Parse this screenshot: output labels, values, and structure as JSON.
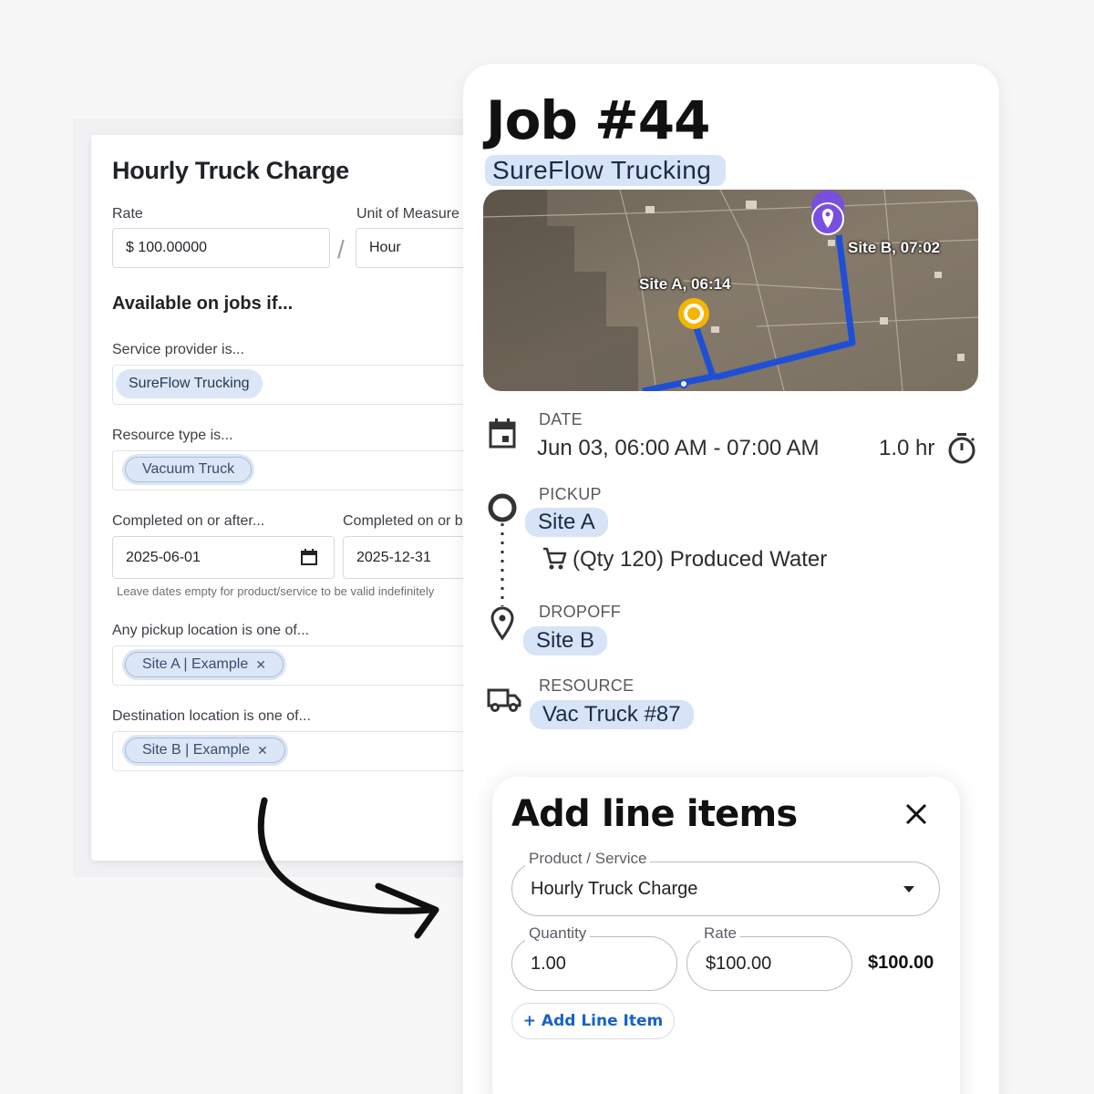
{
  "pricing_form": {
    "title": "Hourly Truck Charge",
    "rate_label": "Rate",
    "rate_currency": "$",
    "rate_value": "100.00000",
    "uom_label": "Unit of Measure",
    "uom_value": "Hour",
    "section_heading": "Available on jobs if...",
    "service_provider_label": "Service provider is...",
    "service_provider_chip": "SureFlow Trucking",
    "resource_type_label": "Resource type is...",
    "resource_type_chip": "Vacuum Truck",
    "completed_after_label": "Completed on or after...",
    "completed_after_value": "2025-06-01",
    "completed_before_label": "Completed on or b",
    "completed_before_value": "2025-12-31",
    "dates_hint": "Leave dates empty for product/service to be valid indefinitely",
    "pickup_label": "Any pickup location is one of...",
    "pickup_chip": "Site A | Example",
    "destination_label": "Destination location is one of...",
    "destination_chip": "Site B | Example",
    "chip_remove_glyph": "✕"
  },
  "job": {
    "title": "Job #44",
    "company": "SureFlow Trucking",
    "map": {
      "site_a_label": "Site A, 06:14",
      "site_b_label": "Site B, 07:02",
      "route_color": "#1e4fd6",
      "site_a_color": "#f5b400",
      "site_b_color": "#7a4fe0"
    },
    "date_label": "DATE",
    "date_value": "Jun 03, 06:00 AM - 07:00 AM",
    "duration": "1.0 hr",
    "pickup_label": "PICKUP",
    "pickup_site": "Site A",
    "pickup_product": "(Qty 120) Produced Water",
    "dropoff_label": "DROPOFF",
    "dropoff_site": "Site B",
    "resource_label": "RESOURCE",
    "resource_value": "Vac Truck #87"
  },
  "modal": {
    "title": "Add line items",
    "product_label": "Product / Service",
    "product_value": "Hourly Truck Charge",
    "quantity_label": "Quantity",
    "quantity_value": "1.00",
    "rate_label": "Rate",
    "rate_value": "$100.00",
    "line_total": "$100.00",
    "add_button": "+ Add Line Item"
  },
  "colors": {
    "chip_bg": "#dbe6f7",
    "accent_blue": "#1862c9"
  }
}
